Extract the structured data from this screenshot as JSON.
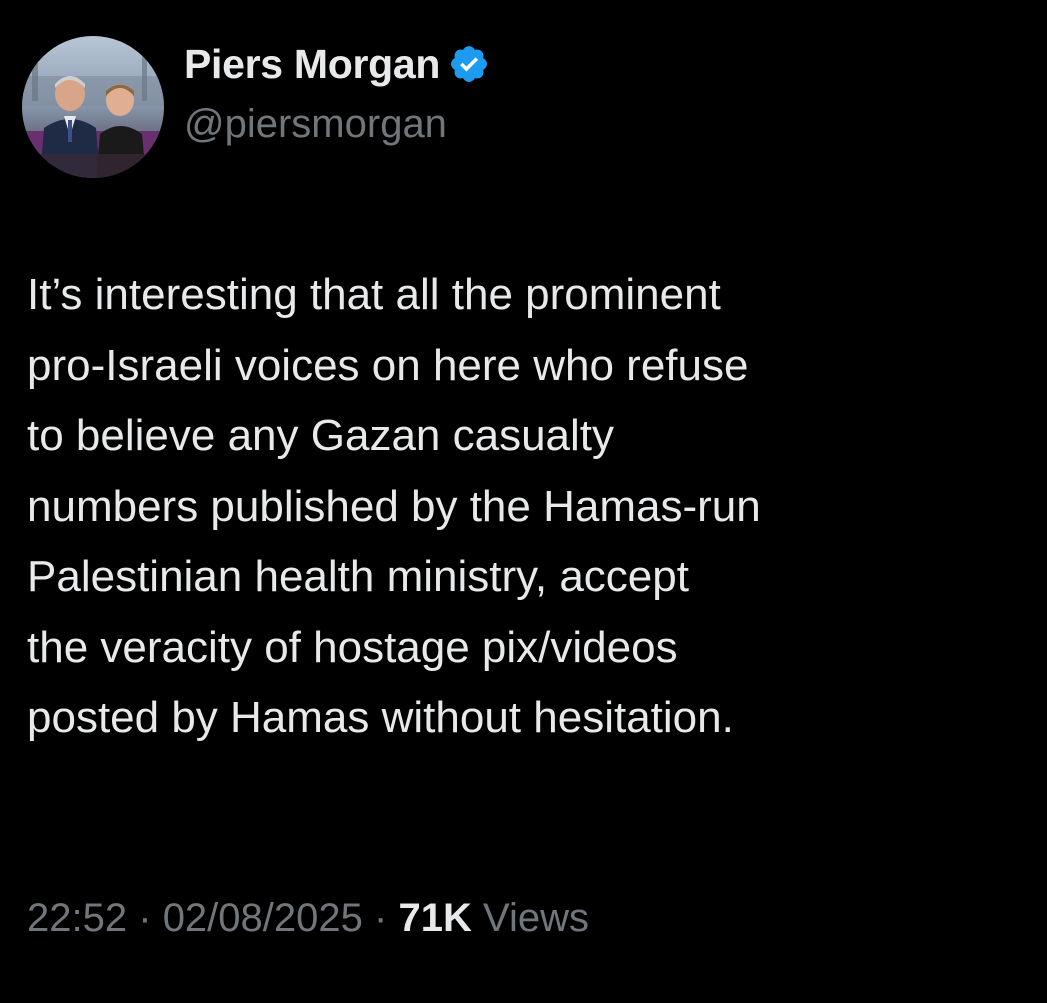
{
  "author": {
    "display_name": "Piers Morgan",
    "handle": "@piersmorgan",
    "verified": true,
    "verified_color": "#1d9bf0"
  },
  "tweet": {
    "text": "It’s interesting that all the  prominent\npro-Israeli voices on here who refuse\nto believe any Gazan casualty\nnumbers published by the Hamas-run\nPalestinian health ministry, accept\nthe veracity of hostage pix/videos\nposted by Hamas without hesitation."
  },
  "meta": {
    "time": "22:52",
    "separator": "·",
    "date": "02/08/2025",
    "views_count": "71K",
    "views_label": "Views"
  },
  "icons": {
    "avatar": "profile-photo",
    "verified": "verified-badge-icon"
  },
  "colors": {
    "background": "#000000",
    "primary_text": "#e7e9ea",
    "secondary_text": "#71767b",
    "accent": "#1d9bf0"
  }
}
